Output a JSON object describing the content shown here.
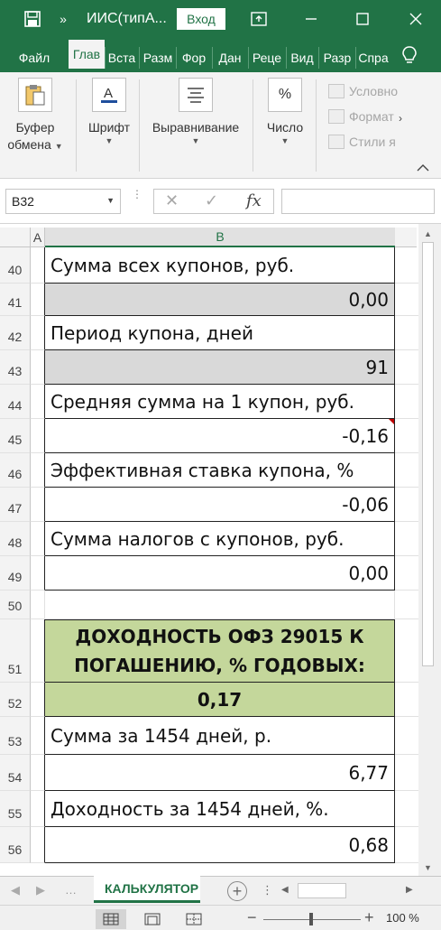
{
  "titlebar": {
    "doc_title": "ИИС(типА...",
    "signin_label": "Вход"
  },
  "tabs": [
    {
      "label": "Файл",
      "active": false
    },
    {
      "label": "Глав",
      "active": true
    },
    {
      "label": "Вста",
      "active": false
    },
    {
      "label": "Разм",
      "active": false
    },
    {
      "label": "Фор",
      "active": false
    },
    {
      "label": "Дан",
      "active": false
    },
    {
      "label": "Реце",
      "active": false
    },
    {
      "label": "Вид",
      "active": false
    },
    {
      "label": "Разр",
      "active": false
    },
    {
      "label": "Спра",
      "active": false
    }
  ],
  "ribbon": {
    "clipboard_label": "Буфер обмена",
    "font_label": "Шрифт",
    "alignment_label": "Выравнивание",
    "number_label": "Число",
    "styles": [
      "Условно",
      "Формат",
      "Стили я"
    ]
  },
  "formula_bar": {
    "name_box": "B32",
    "formula": ""
  },
  "grid": {
    "col_a": "A",
    "col_b": "B",
    "rows": [
      {
        "num": "40",
        "text": "Сумма всех купонов, руб."
      },
      {
        "num": "41",
        "text": "0,00"
      },
      {
        "num": "42",
        "text": "Период купона, дней"
      },
      {
        "num": "43",
        "text": "91"
      },
      {
        "num": "44",
        "text": "Средняя сумма на 1 купон, руб."
      },
      {
        "num": "45",
        "text": "-0,16"
      },
      {
        "num": "46",
        "text": "Эффективная ставка купона, %"
      },
      {
        "num": "47",
        "text": "-0,06"
      },
      {
        "num": "48",
        "text": "Сумма налогов с купонов, руб."
      },
      {
        "num": "49",
        "text": "0,00"
      },
      {
        "num": "50",
        "text": ""
      },
      {
        "num": "51",
        "text": "ДОХОДНОСТЬ ОФЗ 29015 К ПОГАШЕНИЮ, % ГОДОВЫХ:"
      },
      {
        "num": "52",
        "text": "0,17"
      },
      {
        "num": "53",
        "text": "Сумма за 1454 дней, р."
      },
      {
        "num": "54",
        "text": "6,77"
      },
      {
        "num": "55",
        "text": "Доходность за 1454 дней, %."
      },
      {
        "num": "56",
        "text": "0,68"
      }
    ]
  },
  "sheet_tab": "КАЛЬКУЛЯТОР",
  "status": {
    "zoom": "100 %"
  },
  "colors": {
    "accent": "#217346",
    "grey_cell": "#d9d9d9",
    "green_cell": "#c4d79b",
    "comment_marker": "#c00000"
  }
}
